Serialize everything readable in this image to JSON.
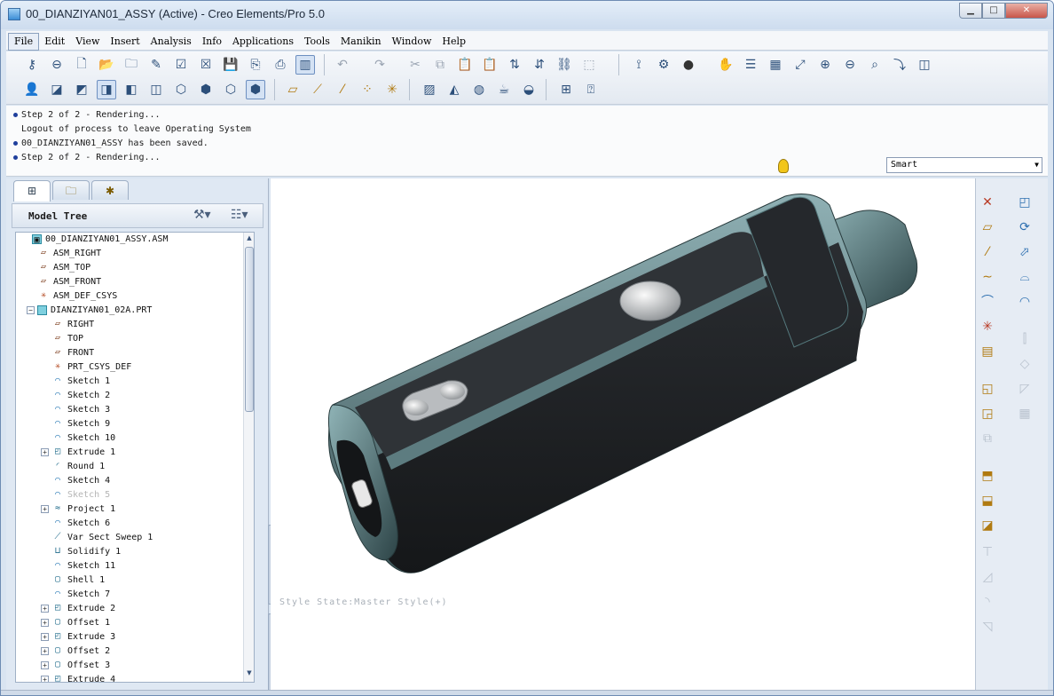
{
  "window": {
    "title": "00_DIANZIYAN01_ASSY (Active) - Creo Elements/Pro 5.0",
    "min_glyph": "▁",
    "max_glyph": "□",
    "close_glyph": "✕"
  },
  "menu": [
    "File",
    "Edit",
    "View",
    "Insert",
    "Analysis",
    "Info",
    "Applications",
    "Tools",
    "Manikin",
    "Window",
    "Help"
  ],
  "messages": [
    {
      "bullet": true,
      "text": "Step 2 of 2 - Rendering..."
    },
    {
      "bullet": false,
      "text": "Logout of process to leave Operating System"
    },
    {
      "bullet": true,
      "text": "00_DIANZIYAN01_ASSY has been saved."
    },
    {
      "bullet": true,
      "text": "Step 2 of 2 - Rendering..."
    }
  ],
  "filter": {
    "value": "Smart",
    "arrow": "▼"
  },
  "model_tree": {
    "title": "Model Tree",
    "rows": [
      {
        "label": "00_DIANZIYAN01_ASSY.ASM",
        "icon": "assembly-icon",
        "glyph": "▣",
        "level": 0,
        "expand": "",
        "dim": false
      },
      {
        "label": "ASM_RIGHT",
        "icon": "datum-plane-icon",
        "glyph": "▱",
        "level": 1,
        "expand": "",
        "dim": false
      },
      {
        "label": "ASM_TOP",
        "icon": "datum-plane-icon",
        "glyph": "▱",
        "level": 1,
        "expand": "",
        "dim": false
      },
      {
        "label": "ASM_FRONT",
        "icon": "datum-plane-icon",
        "glyph": "▱",
        "level": 1,
        "expand": "",
        "dim": false
      },
      {
        "label": "ASM_DEF_CSYS",
        "icon": "csys-icon",
        "glyph": "✳",
        "level": 1,
        "expand": "",
        "dim": false
      },
      {
        "label": "DIANZIYAN01_02A.PRT",
        "icon": "part-icon",
        "glyph": "",
        "level": 1,
        "expand": "−",
        "dim": false
      },
      {
        "label": "RIGHT",
        "icon": "datum-plane-icon",
        "glyph": "▱",
        "level": 2,
        "expand": "",
        "dim": false
      },
      {
        "label": "TOP",
        "icon": "datum-plane-icon",
        "glyph": "▱",
        "level": 2,
        "expand": "",
        "dim": false
      },
      {
        "label": "FRONT",
        "icon": "datum-plane-icon",
        "glyph": "▱",
        "level": 2,
        "expand": "",
        "dim": false
      },
      {
        "label": "PRT_CSYS_DEF",
        "icon": "csys-icon",
        "glyph": "✳",
        "level": 2,
        "expand": "",
        "dim": false
      },
      {
        "label": "Sketch 1",
        "icon": "sketch-icon",
        "glyph": "⌒",
        "level": 2,
        "expand": "",
        "dim": false
      },
      {
        "label": "Sketch 2",
        "icon": "sketch-icon",
        "glyph": "⌒",
        "level": 2,
        "expand": "",
        "dim": false
      },
      {
        "label": "Sketch 3",
        "icon": "sketch-icon",
        "glyph": "⌒",
        "level": 2,
        "expand": "",
        "dim": false
      },
      {
        "label": "Sketch 9",
        "icon": "sketch-icon",
        "glyph": "⌒",
        "level": 2,
        "expand": "",
        "dim": false
      },
      {
        "label": "Sketch 10",
        "icon": "sketch-icon",
        "glyph": "⌒",
        "level": 2,
        "expand": "",
        "dim": false
      },
      {
        "label": "Extrude 1",
        "icon": "extrude-icon",
        "glyph": "◰",
        "level": 2,
        "expand": "+",
        "dim": false
      },
      {
        "label": "Round 1",
        "icon": "round-icon",
        "glyph": "◜",
        "level": 2,
        "expand": "",
        "dim": false
      },
      {
        "label": "Sketch 4",
        "icon": "sketch-icon",
        "glyph": "⌒",
        "level": 2,
        "expand": "",
        "dim": false
      },
      {
        "label": "Sketch 5",
        "icon": "sketch-icon",
        "glyph": "⌒",
        "level": 2,
        "expand": "",
        "dim": true
      },
      {
        "label": "Project 1",
        "icon": "project-icon",
        "glyph": "≈",
        "level": 2,
        "expand": "+",
        "dim": false
      },
      {
        "label": "Sketch 6",
        "icon": "sketch-icon",
        "glyph": "⌒",
        "level": 2,
        "expand": "",
        "dim": false
      },
      {
        "label": "Var Sect Sweep 1",
        "icon": "sweep-icon",
        "glyph": "⟋",
        "level": 2,
        "expand": "",
        "dim": false
      },
      {
        "label": "Solidify 1",
        "icon": "solidify-icon",
        "glyph": "⊔",
        "level": 2,
        "expand": "",
        "dim": false
      },
      {
        "label": "Sketch 11",
        "icon": "sketch-icon",
        "glyph": "⌒",
        "level": 2,
        "expand": "",
        "dim": false
      },
      {
        "label": "Shell 1",
        "icon": "shell-icon",
        "glyph": "▢",
        "level": 2,
        "expand": "",
        "dim": false
      },
      {
        "label": "Sketch 7",
        "icon": "sketch-icon",
        "glyph": "⌒",
        "level": 2,
        "expand": "",
        "dim": false
      },
      {
        "label": "Extrude 2",
        "icon": "extrude-icon",
        "glyph": "◰",
        "level": 2,
        "expand": "+",
        "dim": false
      },
      {
        "label": "Offset 1",
        "icon": "offset-icon",
        "glyph": "▢",
        "level": 2,
        "expand": "+",
        "dim": false
      },
      {
        "label": "Extrude 3",
        "icon": "extrude-icon",
        "glyph": "◰",
        "level": 2,
        "expand": "+",
        "dim": false
      },
      {
        "label": "Offset 2",
        "icon": "offset-icon",
        "glyph": "▢",
        "level": 2,
        "expand": "+",
        "dim": false
      },
      {
        "label": "Offset 3",
        "icon": "offset-icon",
        "glyph": "▢",
        "level": 2,
        "expand": "+",
        "dim": false
      },
      {
        "label": "Extrude 4",
        "icon": "extrude-icon",
        "glyph": "◰",
        "level": 2,
        "expand": "+",
        "dim": false
      }
    ]
  },
  "graphics": {
    "style_state": "Style State:Master Style(+)"
  }
}
